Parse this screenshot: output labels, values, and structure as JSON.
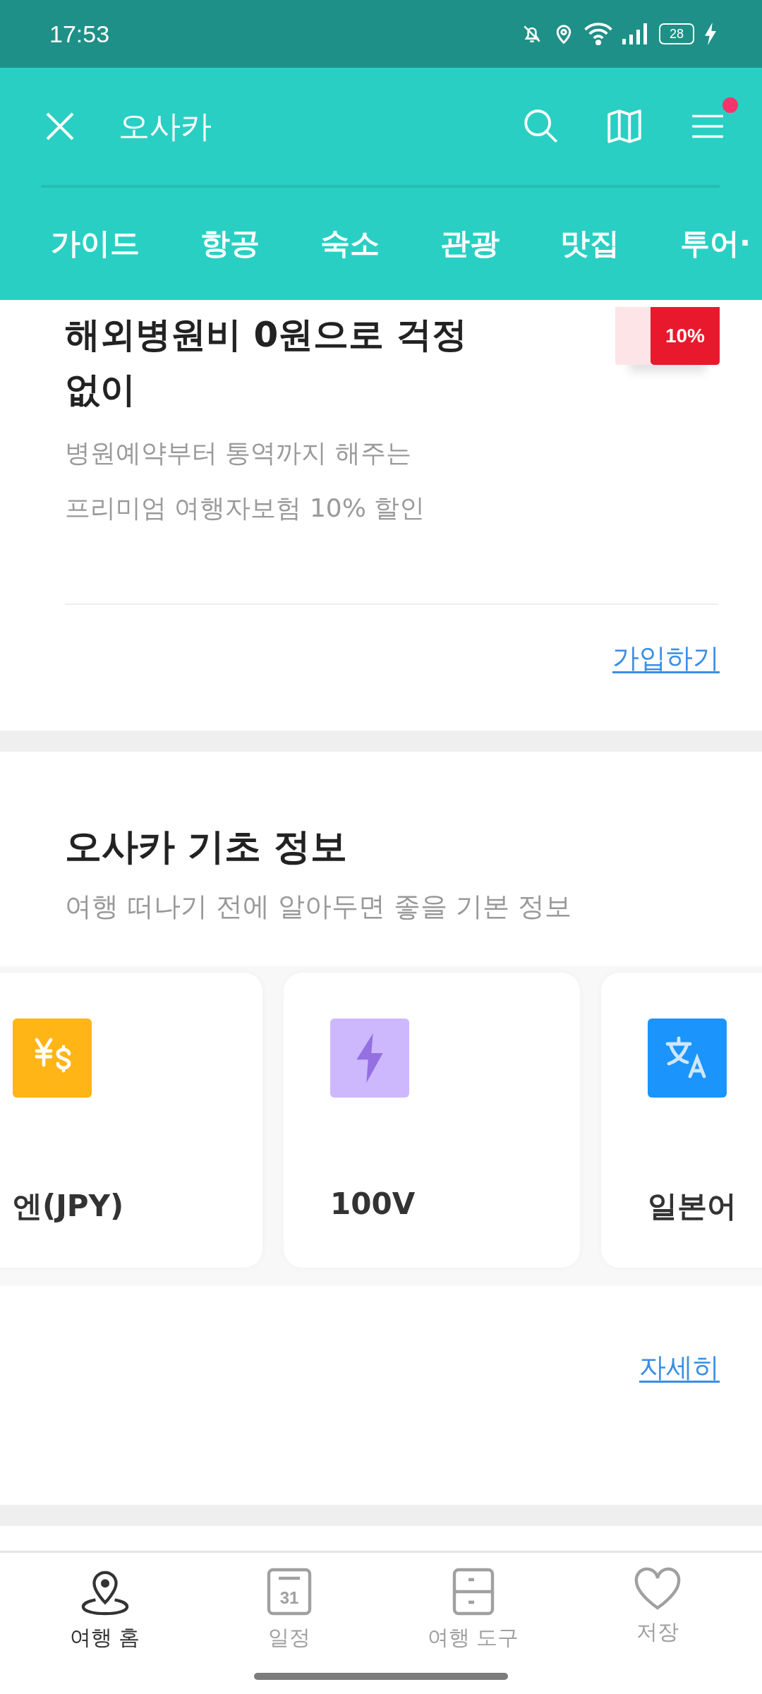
{
  "status_bar": {
    "time": "17:53",
    "battery": "28"
  },
  "header": {
    "title": "오사카",
    "menu_badge": true
  },
  "tabs": [
    {
      "label": "가이드",
      "selected": false
    },
    {
      "label": "항공",
      "selected": false
    },
    {
      "label": "숙소",
      "selected": false
    },
    {
      "label": "관광",
      "selected": false
    },
    {
      "label": "맛집",
      "selected": false
    },
    {
      "label": "투어·",
      "selected": false
    }
  ],
  "promo": {
    "title": "해외병원비 0원으로 걱정 없이",
    "subtitle_lines": [
      "병원예약부터 통역까지 해주는",
      "프리미엄 여행자보험 10% 할인"
    ],
    "image_tag": "10%",
    "link": "가입하기"
  },
  "basic_info": {
    "title": "오사카 기초 정보",
    "subtitle": "여행 떠나기 전에 알아두면 좋을 기본 정보",
    "cards": [
      {
        "kind": "currency",
        "label": "엔(JPY)"
      },
      {
        "kind": "voltage",
        "label": "100V"
      },
      {
        "kind": "language",
        "label": "일본어"
      }
    ],
    "link": "자세히"
  },
  "bottom_nav": [
    {
      "kind": "home",
      "label": "여행 홈",
      "selected": true
    },
    {
      "kind": "schedule",
      "label": "일정",
      "icon_text": "31",
      "selected": false
    },
    {
      "kind": "tools",
      "label": "여행 도구",
      "selected": false
    },
    {
      "kind": "saved",
      "label": "저장",
      "selected": false
    }
  ]
}
